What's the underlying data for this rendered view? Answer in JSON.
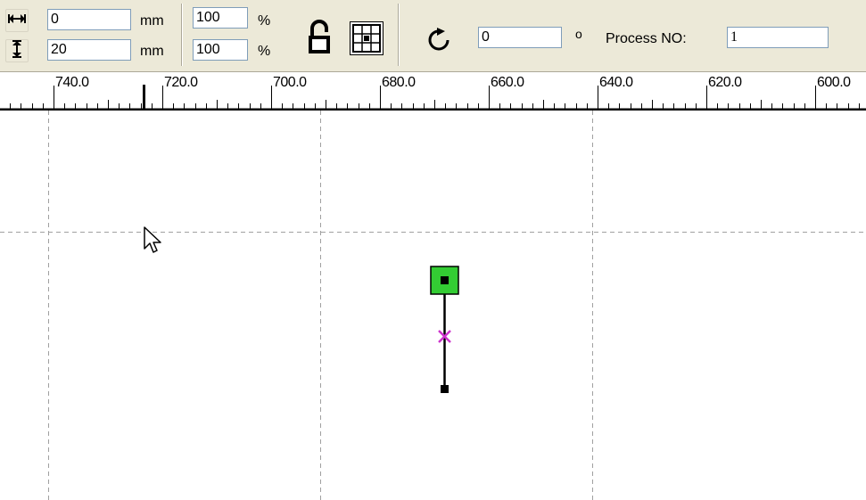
{
  "toolbar": {
    "width_value": "0",
    "height_value": "20",
    "width_unit": "mm",
    "height_unit": "mm",
    "scale_x_value": "100",
    "scale_y_value": "100",
    "scale_x_unit": "%",
    "scale_y_unit": "%",
    "rotation_value": "0",
    "rotation_unit": "o",
    "process_label": "Process NO:",
    "process_value": "1"
  },
  "ruler": {
    "labels": [
      "740.0",
      "720.0",
      "700.0",
      "680.0",
      "660.0",
      "640.0",
      "620.0",
      "600.0"
    ]
  },
  "icons": {
    "width_arrow": "horizontal-double-arrow",
    "height_arrow": "vertical-double-arrow",
    "lock": "padlock-open",
    "grid": "grid-align",
    "rotate": "rotate-clockwise",
    "cursor": "mouse-pointer"
  },
  "colors": {
    "selection_handle": "#33cc33",
    "center_mark": "#cc33cc",
    "guide_line": "#a0a0a0",
    "toolbar_bg": "#ece9d8"
  }
}
